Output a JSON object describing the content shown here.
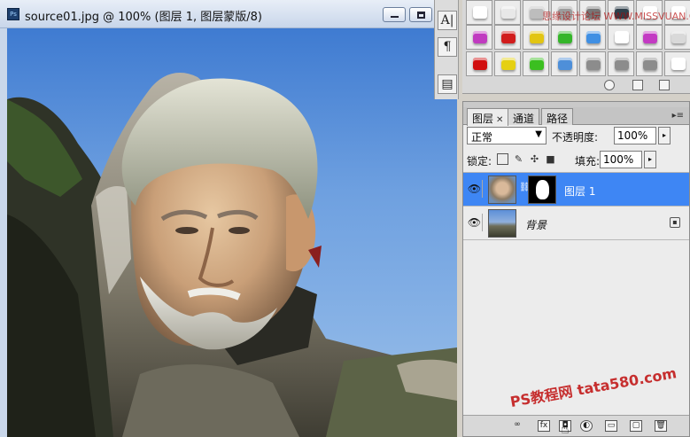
{
  "document": {
    "title": "source01.jpg @ 100% (图层 1, 图层蒙版/8)"
  },
  "tool_strip": {
    "items": [
      "A|",
      "¶",
      "▤"
    ]
  },
  "styles_palette": {
    "rows": [
      [
        "#ffffff",
        "#e8e8e8",
        "#bdbdbd",
        "#9c9c9c",
        "#777777",
        "#2f3f4a",
        "#ffffff",
        "#ffffff"
      ],
      [
        "#c03bc0",
        "#d11c1c",
        "#e2c513",
        "#35b52a",
        "#3f8fe3",
        "#ffffff",
        "#c33ac3",
        "#d9d9d9"
      ],
      [
        "#d10f0f",
        "#e5d012",
        "#3bbf20",
        "#4e8fd9",
        "#8c8c8c",
        "#8c8c8c",
        "#8c8c8c",
        "#ffffff"
      ]
    ]
  },
  "layers_panel": {
    "tabs": [
      {
        "label": "图层",
        "active": true
      },
      {
        "label": "通道",
        "active": false
      },
      {
        "label": "路径",
        "active": false
      }
    ],
    "blend_mode": "正常",
    "opacity_label": "不透明度:",
    "opacity_value": "100%",
    "lock_label": "锁定:",
    "fill_label": "填充:",
    "fill_value": "100%",
    "layers": [
      {
        "name": "图层 1",
        "selected": true,
        "has_mask": true,
        "visible": true
      },
      {
        "name": "背景",
        "selected": false,
        "has_mask": false,
        "visible": true,
        "locked": true
      }
    ]
  },
  "watermarks": {
    "top": "思缘设计论坛 WWW.MISSVUAN.COM",
    "bottom": "PS教程网 tata580.com"
  },
  "colors": {
    "selection": "#3e86f4",
    "sky": "#6ea0e0",
    "panel": "#ececec"
  }
}
